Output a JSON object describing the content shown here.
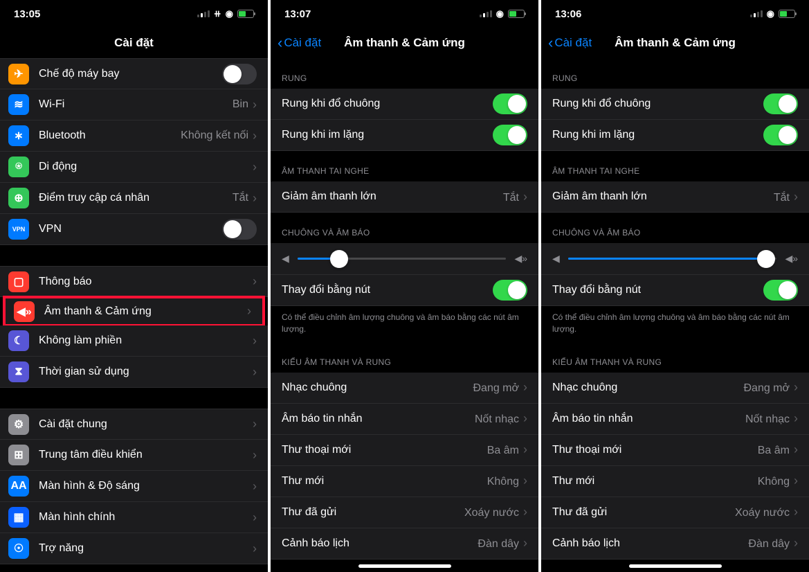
{
  "screen1": {
    "time": "13:05",
    "title": "Cài đặt",
    "rows": [
      {
        "icon": "✈︎",
        "iconClass": "ic-orange",
        "label": "Chế độ máy bay",
        "type": "switch",
        "on": false,
        "name": "airplane-mode-row"
      },
      {
        "icon": "≋",
        "iconClass": "ic-blue",
        "label": "Wi-Fi",
        "type": "nav",
        "value": "Bin",
        "name": "wifi-row"
      },
      {
        "icon": "∗",
        "iconClass": "ic-blue",
        "label": "Bluetooth",
        "type": "nav",
        "value": "Không kết nối",
        "name": "bluetooth-row"
      },
      {
        "icon": "⍟",
        "iconClass": "ic-green",
        "label": "Di động",
        "type": "nav",
        "value": "",
        "name": "cellular-row"
      },
      {
        "icon": "⊕",
        "iconClass": "ic-green",
        "label": "Điểm truy cập cá nhân",
        "type": "nav",
        "value": "Tắt",
        "name": "hotspot-row"
      },
      {
        "icon": "VPN",
        "iconClass": "ic-blue",
        "label": "VPN",
        "type": "switch",
        "on": false,
        "name": "vpn-row"
      }
    ],
    "rows2": [
      {
        "icon": "▢",
        "iconClass": "ic-red",
        "label": "Thông báo",
        "type": "nav",
        "value": "",
        "name": "notifications-row"
      },
      {
        "icon": "◀»",
        "iconClass": "ic-red",
        "label": "Âm thanh & Cảm ứng",
        "type": "nav",
        "value": "",
        "name": "sounds-row",
        "highlight": true
      },
      {
        "icon": "☾",
        "iconClass": "ic-purple",
        "label": "Không làm phiền",
        "type": "nav",
        "value": "",
        "name": "dnd-row"
      },
      {
        "icon": "⧗",
        "iconClass": "ic-purple",
        "label": "Thời gian sử dụng",
        "type": "nav",
        "value": "",
        "name": "screentime-row"
      }
    ],
    "rows3": [
      {
        "icon": "⚙",
        "iconClass": "ic-gray",
        "label": "Cài đặt chung",
        "type": "nav",
        "value": "",
        "name": "general-row"
      },
      {
        "icon": "⊞",
        "iconClass": "ic-gray",
        "label": "Trung tâm điều khiển",
        "type": "nav",
        "value": "",
        "name": "control-center-row"
      },
      {
        "icon": "AA",
        "iconClass": "ic-blue",
        "label": "Màn hình & Độ sáng",
        "type": "nav",
        "value": "",
        "name": "display-row"
      },
      {
        "icon": "▦",
        "iconClass": "ic-darkblue",
        "label": "Màn hình chính",
        "type": "nav",
        "value": "",
        "name": "homescreen-row"
      },
      {
        "icon": "☉",
        "iconClass": "ic-blue",
        "label": "Trợ năng",
        "type": "nav",
        "value": "",
        "name": "accessibility-row"
      }
    ]
  },
  "screen2": {
    "time": "13:07",
    "back": "Cài đặt",
    "title": "Âm thanh & Cảm ứng",
    "sections": {
      "rung": "RUNG",
      "headphone": "ÂM THANH TAI NGHE",
      "ringer": "CHUÔNG VÀ ÂM BÁO",
      "pattern": "KIỂU ÂM THANH VÀ RUNG"
    },
    "vibrate_ring": "Rung khi đổ chuông",
    "vibrate_silent": "Rung khi im lặng",
    "reduce_loud": "Giảm âm thanh lớn",
    "reduce_loud_value": "Tắt",
    "change_buttons": "Thay đổi bằng nút",
    "footer": "Có thể điều chỉnh âm lượng chuông và âm báo bằng các nút âm lượng.",
    "slider_pct": 20,
    "sounds": [
      {
        "label": "Nhạc chuông",
        "value": "Đang mở",
        "name": "ringtone-row"
      },
      {
        "label": "Âm báo tin nhắn",
        "value": "Nốt nhạc",
        "name": "text-tone-row"
      },
      {
        "label": "Thư thoại mới",
        "value": "Ba âm",
        "name": "voicemail-row"
      },
      {
        "label": "Thư mới",
        "value": "Không",
        "name": "new-mail-row"
      },
      {
        "label": "Thư đã gửi",
        "value": "Xoáy nước",
        "name": "sent-mail-row"
      },
      {
        "label": "Cảnh báo lịch",
        "value": "Đàn dây",
        "name": "calendar-row"
      }
    ]
  },
  "screen3": {
    "time": "13:06",
    "back": "Cài đặt",
    "title": "Âm thanh & Cảm ứng",
    "slider_pct": 95
  }
}
